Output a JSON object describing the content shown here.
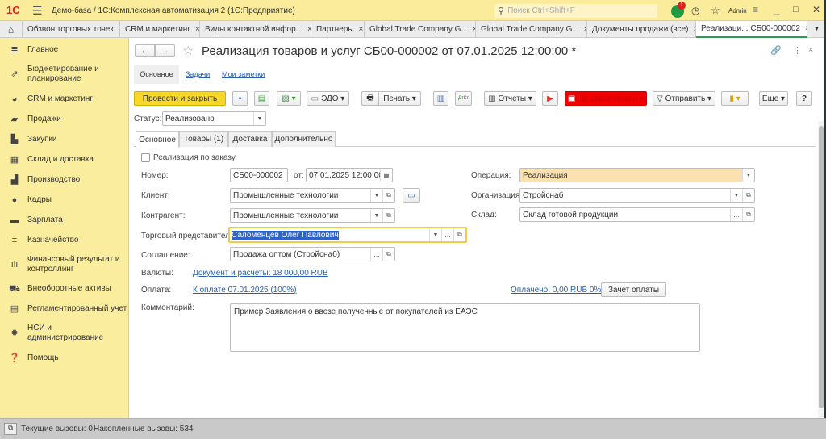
{
  "window": {
    "title": "Демо-база / 1С:Комплексная автоматизация 2  (1С:Предприятие)",
    "search_placeholder": "Поиск Ctrl+Shift+F",
    "notification_count": "1",
    "user": "Admin"
  },
  "window_tabs": [
    {
      "label": "Обзвон торговых точек"
    },
    {
      "label": "CRM и маркетинг"
    },
    {
      "label": "Виды контактной инфор..."
    },
    {
      "label": "Партнеры"
    },
    {
      "label": "Global Trade Company G..."
    },
    {
      "label": "Global Trade Company G..."
    },
    {
      "label": "Документы продажи (все)"
    },
    {
      "label": "Реализаци...  СБ00-000002"
    }
  ],
  "sidebar": {
    "items": [
      {
        "label": "Главное",
        "icon": "menu-icon"
      },
      {
        "label": "Бюджетирование и планирование",
        "icon": "budget-icon"
      },
      {
        "label": "CRM и маркетинг",
        "icon": "pie-chart-icon"
      },
      {
        "label": "Продажи",
        "icon": "bag-icon"
      },
      {
        "label": "Закупки",
        "icon": "cart-icon"
      },
      {
        "label": "Склад и доставка",
        "icon": "warehouse-icon"
      },
      {
        "label": "Производство",
        "icon": "factory-icon"
      },
      {
        "label": "Кадры",
        "icon": "person-icon"
      },
      {
        "label": "Зарплата",
        "icon": "card-icon"
      },
      {
        "label": "Казначейство",
        "icon": "coins-icon"
      },
      {
        "label": "Финансовый результат и контроллинг",
        "icon": "bar-chart-icon"
      },
      {
        "label": "Внеоборотные активы",
        "icon": "truck-icon"
      },
      {
        "label": "Регламентированный учет",
        "icon": "calculator-icon"
      },
      {
        "label": "НСИ и администрирование",
        "icon": "gear-icon"
      },
      {
        "label": "Помощь",
        "icon": "help-icon"
      }
    ]
  },
  "document": {
    "title": "Реализация товаров и услуг СБ00-000002 от 07.01.2025 12:00:00 *",
    "sections": [
      "Основное",
      "Задачи",
      "Мои заметки"
    ],
    "toolbar": {
      "post_close": "Провести и закрыть",
      "edo": "ЭДО",
      "print": "Печать",
      "reports": "Отчеты",
      "not_printed": "Не распечатано",
      "send": "Отправить",
      "more": "Еще",
      "help": "?"
    },
    "status_label": "Статус:",
    "status_value": "Реализовано",
    "tabs": [
      "Основное",
      "Товары (1)",
      "Доставка",
      "Дополнительно"
    ],
    "by_order_label": "Реализация по заказу",
    "fields": {
      "number_label": "Номер:",
      "number": "СБ00-000002",
      "from_label": "от:",
      "date": "07.01.2025 12:00:00",
      "client_label": "Клиент:",
      "client": "Промышленные технологии",
      "counterparty_label": "Контрагент:",
      "counterparty": "Промышленные технологии",
      "rep_label": "Торговый представитель:",
      "rep": "Саломенцев Олег Павлович",
      "agreement_label": "Соглашение:",
      "agreement": "Продажа оптом (Стройснаб)",
      "currency_label": "Валюты:",
      "currency_link": "Документ и расчеты: 18 000,00 RUB",
      "payment_label": "Оплата:",
      "payment_link": "К оплате 07.01.2025 (100%)",
      "paid_link": "Оплачено: 0,00 RUB 0%",
      "offset_button": "Зачет оплаты",
      "comment_label": "Комментарий:",
      "comment": "Пример Заявления о ввозе полученные от покупателей из ЕАЭС",
      "operation_label": "Операция:",
      "operation": "Реализация",
      "org_label": "Организация:",
      "org": "Стройснаб",
      "warehouse_label": "Склад:",
      "warehouse": "Склад готовой продукции"
    }
  },
  "statusbar": {
    "current_calls": "Текущие вызовы: 0",
    "accumulated_calls": "Накопленные вызовы: 534"
  }
}
